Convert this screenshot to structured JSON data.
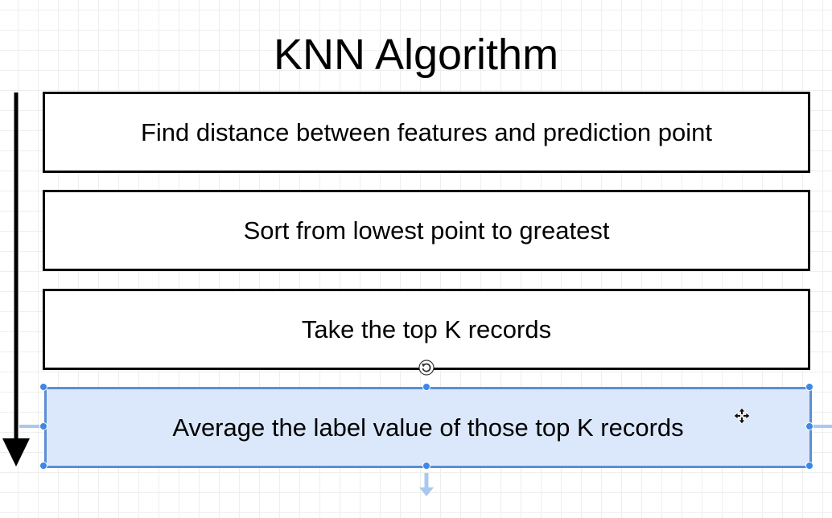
{
  "title": "KNN Algorithm",
  "steps": [
    "Find distance between features and prediction point",
    "Sort from lowest point to greatest",
    "Take the top K records",
    "Average the label value of those top K records"
  ],
  "selected_step": 4,
  "colors": {
    "selection_fill": "#dbe8fb",
    "selection_border": "#5b8fd4",
    "handle": "#3d88e4"
  },
  "icons": [
    "rotate-handle-icon",
    "move-cursor-icon",
    "flow-arrow"
  ]
}
